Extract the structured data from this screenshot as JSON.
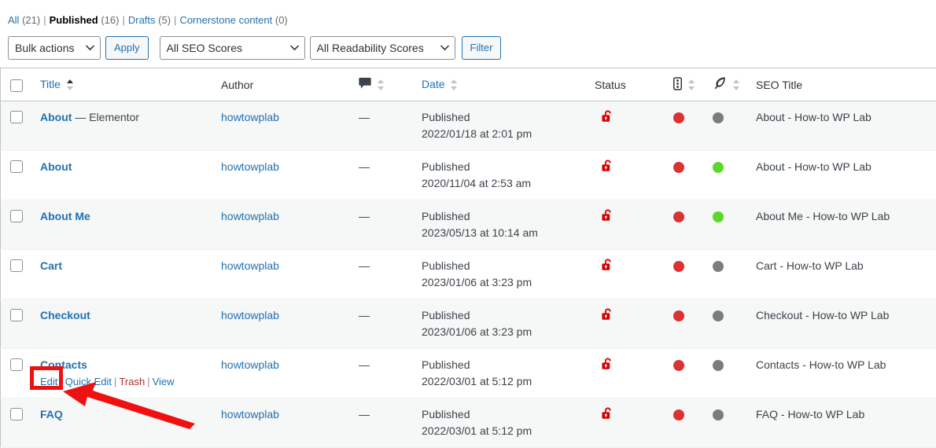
{
  "views": {
    "items": [
      {
        "label": "All",
        "count": "(21)",
        "current": false
      },
      {
        "label": "Published",
        "count": "(16)",
        "current": true
      },
      {
        "label": "Drafts",
        "count": "(5)",
        "current": false
      },
      {
        "label": "Cornerstone content",
        "count": "(0)",
        "current": false
      }
    ],
    "separator": "|"
  },
  "tablenav": {
    "bulk_actions_value": "Bulk actions",
    "apply_label": "Apply",
    "seo_scores_value": "All SEO Scores",
    "readability_scores_value": "All Readability Scores",
    "filter_label": "Filter"
  },
  "table": {
    "columns": {
      "title": "Title",
      "author": "Author",
      "comments_icon": "comment-bubble-icon",
      "date": "Date",
      "status": "Status",
      "seo_icon": "seo-score-icon",
      "readability_icon": "readability-feather-icon",
      "seo_title": "SEO Title"
    },
    "rows": [
      {
        "title": "About",
        "title_suffix": " — Elementor",
        "author": "howtowplab",
        "comments": "—",
        "date_status": "Published",
        "date_value": "2022/01/18 at 2:01 pm",
        "lock": "open-lock-icon",
        "seo_score": "red",
        "readability_score": "grey",
        "seo_title": "About - How-to WP Lab",
        "alt": true
      },
      {
        "title": "About",
        "title_suffix": "",
        "author": "howtowplab",
        "comments": "—",
        "date_status": "Published",
        "date_value": "2020/11/04 at 2:53 am",
        "lock": "open-lock-icon",
        "seo_score": "red",
        "readability_score": "green",
        "seo_title": "About - How-to WP Lab",
        "alt": false
      },
      {
        "title": "About Me",
        "title_suffix": "",
        "author": "howtowplab",
        "comments": "—",
        "date_status": "Published",
        "date_value": "2023/05/13 at 10:14 am",
        "lock": "open-lock-icon",
        "seo_score": "red",
        "readability_score": "green",
        "seo_title": "About Me - How-to WP Lab",
        "alt": true
      },
      {
        "title": "Cart",
        "title_suffix": "",
        "author": "howtowplab",
        "comments": "—",
        "date_status": "Published",
        "date_value": "2023/01/06 at 3:23 pm",
        "lock": "open-lock-icon",
        "seo_score": "red",
        "readability_score": "grey",
        "seo_title": "Cart - How-to WP Lab",
        "alt": false
      },
      {
        "title": "Checkout",
        "title_suffix": "",
        "author": "howtowplab",
        "comments": "—",
        "date_status": "Published",
        "date_value": "2023/01/06 at 3:23 pm",
        "lock": "open-lock-icon",
        "seo_score": "red",
        "readability_score": "grey",
        "seo_title": "Checkout - How-to WP Lab",
        "alt": true
      },
      {
        "title": "Contacts",
        "title_suffix": "",
        "author": "howtowplab",
        "comments": "—",
        "date_status": "Published",
        "date_value": "2022/03/01 at 5:12 pm",
        "lock": "open-lock-icon",
        "seo_score": "red",
        "readability_score": "grey",
        "seo_title": "Contacts - How-to WP Lab",
        "alt": false
      },
      {
        "title": "FAQ",
        "title_suffix": "",
        "author": "howtowplab",
        "comments": "—",
        "date_status": "Published",
        "date_value": "2022/03/01 at 5:12 pm",
        "lock": "open-lock-icon",
        "seo_score": "red",
        "readability_score": "grey",
        "seo_title": "FAQ - How-to WP Lab",
        "alt": true
      }
    ],
    "row_actions": {
      "edit": "Edit",
      "quick_edit": "Quick Edit",
      "trash": "Trash",
      "view": "View",
      "separator": "|"
    }
  },
  "annotations": {
    "highlight_box_target": "Edit",
    "arrow": "red-arrow-pointing-to-edit"
  },
  "colors": {
    "link": "#2271b1",
    "trash": "#b32d2e",
    "annotation_red": "#ee1111",
    "score_red": "#dc3232",
    "score_grey": "#7c7c7c",
    "score_green": "#5cd82b",
    "lock_red": "#dc3232",
    "row_alt_bg": "#f6f7f7"
  }
}
